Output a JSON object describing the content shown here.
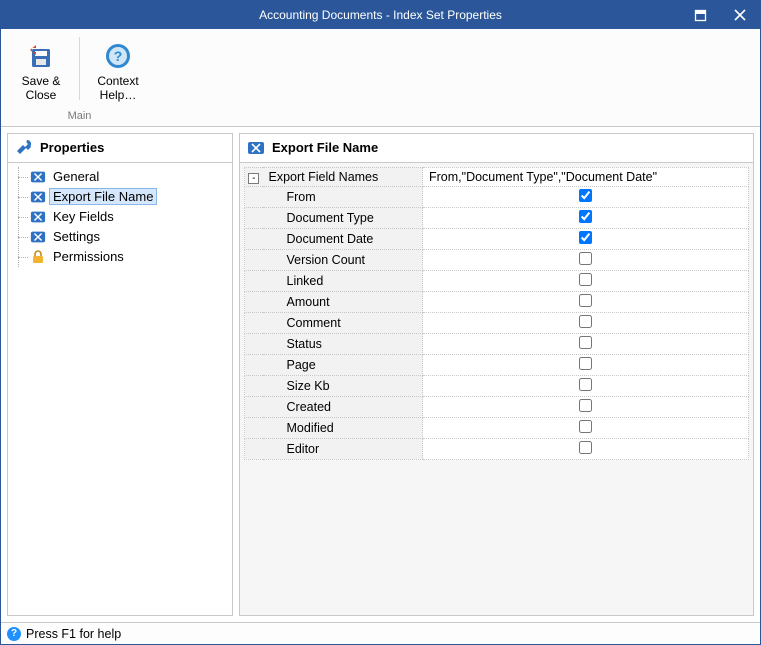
{
  "window": {
    "title": "Accounting Documents - Index Set Properties"
  },
  "ribbon": {
    "save_close_label_1": "Save &",
    "save_close_label_2": "Close",
    "context_help_label_1": "Context",
    "context_help_label_2": "Help…",
    "group_label": "Main"
  },
  "left": {
    "header": "Properties",
    "items": [
      {
        "label": "General",
        "icon": "tag-icon",
        "selected": false
      },
      {
        "label": "Export File Name",
        "icon": "tag-icon",
        "selected": true
      },
      {
        "label": "Key Fields",
        "icon": "tag-icon",
        "selected": false
      },
      {
        "label": "Settings",
        "icon": "tag-icon",
        "selected": false
      },
      {
        "label": "Permissions",
        "icon": "lock-icon",
        "selected": false
      }
    ]
  },
  "right": {
    "header": "Export File Name",
    "root_row": {
      "name": "Export Field Names",
      "value": "From,\"Document Type\",\"Document Date\""
    },
    "fields": [
      {
        "name": "From",
        "checked": true
      },
      {
        "name": "Document Type",
        "checked": true
      },
      {
        "name": "Document Date",
        "checked": true
      },
      {
        "name": "Version Count",
        "checked": false
      },
      {
        "name": "Linked",
        "checked": false
      },
      {
        "name": "Amount",
        "checked": false
      },
      {
        "name": "Comment",
        "checked": false
      },
      {
        "name": "Status",
        "checked": false
      },
      {
        "name": "Page",
        "checked": false
      },
      {
        "name": "Size Kb",
        "checked": false
      },
      {
        "name": "Created",
        "checked": false
      },
      {
        "name": "Modified",
        "checked": false
      },
      {
        "name": "Editor",
        "checked": false
      }
    ]
  },
  "status": {
    "text": "Press F1 for help"
  }
}
